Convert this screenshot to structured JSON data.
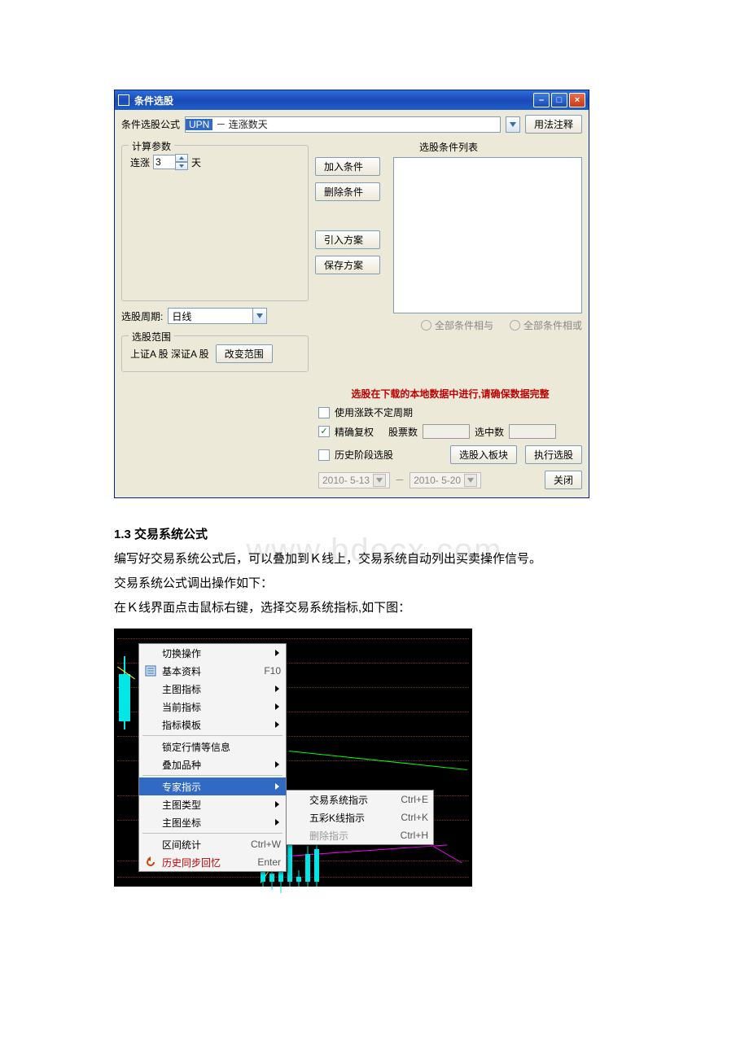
{
  "dialog": {
    "title": "条件选股",
    "formula_label": "条件选股公式",
    "formula_sel": "UPN",
    "formula_rest": "－ 连涨数天",
    "usage_btn": "用法注释",
    "calc_group": "计算参数",
    "param_prefix": "连涨",
    "param_value": "3",
    "param_suffix": "天",
    "period_label": "选股周期:",
    "period_value": "日线",
    "range_group": "选股范围",
    "range_text": "上证A 股  深证A 股",
    "change_range": "改变范围",
    "cond_title": "选股条件列表",
    "add_cond": "加入条件",
    "del_cond": "删除条件",
    "import_plan": "引入方案",
    "save_plan": "保存方案",
    "radio_and": "全部条件相与",
    "radio_or": "全部条件相或",
    "warn": "选股在下载的本地数据中进行,请确保数据完整",
    "chk_volatile": "使用涨跌不定周期",
    "chk_adj": "精确复权",
    "stock_count_label": "股票数",
    "selected_count_label": "选中数",
    "chk_history": "历史阶段选股",
    "date_from": "2010- 5-13",
    "date_to": "2010- 5-20",
    "btn_to_block": "选股入板块",
    "btn_run": "执行选股",
    "btn_close": "关闭"
  },
  "doc": {
    "heading": "1.3 交易系统公式",
    "p1": "编写好交易系统公式后，可以叠加到Ｋ线上，交易系统自动列出买卖操作信号。",
    "p2": "交易系统公式调出操作如下：",
    "p3": "在Ｋ线界面点击鼠标右键，选择交易系统指标,如下图：",
    "watermark": "www.bdocx.com"
  },
  "menu": {
    "items": [
      {
        "label": "切换操作",
        "arrow": true
      },
      {
        "label": "基本资料",
        "shortcut": "F10",
        "icon": "doc"
      },
      {
        "label": "主图指标",
        "arrow": true
      },
      {
        "label": "当前指标",
        "arrow": true
      },
      {
        "label": "指标模板",
        "arrow": true
      },
      {
        "sep": true
      },
      {
        "label": "锁定行情等信息"
      },
      {
        "label": "叠加品种",
        "arrow": true
      },
      {
        "sep": true
      },
      {
        "label": "专家指示",
        "arrow": true,
        "selected": true
      },
      {
        "label": "主图类型",
        "arrow": true
      },
      {
        "label": "主图坐标",
        "arrow": true
      },
      {
        "sep": true
      },
      {
        "label": "区间统计",
        "shortcut": "Ctrl+W"
      },
      {
        "label": "历史同步回忆",
        "shortcut": "Enter",
        "icon": "undo",
        "red": true
      }
    ],
    "sub": [
      {
        "label": "交易系统指示",
        "shortcut": "Ctrl+E"
      },
      {
        "label": "五彩K线指示",
        "shortcut": "Ctrl+K"
      },
      {
        "label": "删除指示",
        "shortcut": "Ctrl+H",
        "disabled": true
      }
    ]
  }
}
